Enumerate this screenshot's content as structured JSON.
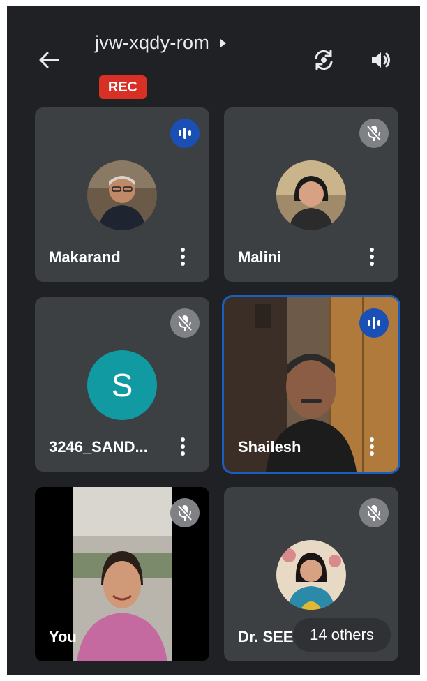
{
  "call": {
    "meeting_code": "jvw-xqdy-rom",
    "recording_label": "REC"
  },
  "participants": [
    {
      "name": "Makarand",
      "status": "speaking"
    },
    {
      "name": "Malini",
      "status": "muted"
    },
    {
      "name": "3246_SAND...",
      "status": "muted",
      "initial": "S",
      "avatar_color": "#129aa3"
    },
    {
      "name": "Shailesh",
      "status": "speaking"
    },
    {
      "name": "You",
      "status": "muted"
    },
    {
      "name": "Dr. SEEM",
      "status": "muted"
    }
  ],
  "others_label": "14 others",
  "colors": {
    "background": "#202124",
    "tile": "#3c4043",
    "rec": "#d93025",
    "speaking": "#1a4fb5",
    "active_border": "#1a5fbf"
  }
}
